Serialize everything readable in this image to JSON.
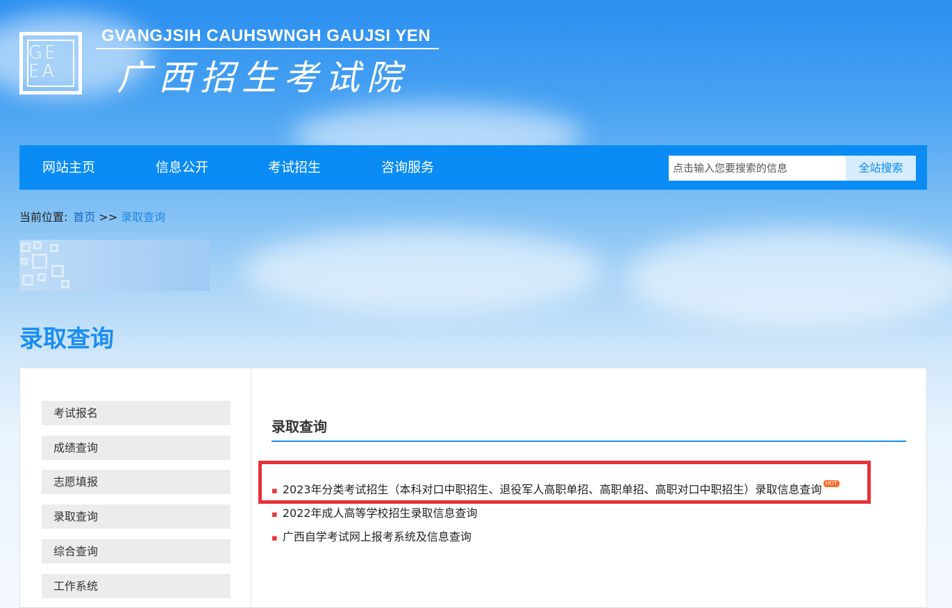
{
  "logo": {
    "letters": "GE EA",
    "en_name": "GVANGJSIH CAUHSWNGH GAUJSI YEN",
    "cn_name": "广西招生考试院"
  },
  "nav": {
    "items": [
      "网站主页",
      "信息公开",
      "考试招生",
      "咨询服务"
    ],
    "search_placeholder": "点击输入您要搜索的信息",
    "search_button": "全站搜索"
  },
  "breadcrumb": {
    "prefix": "当前位置:",
    "home": "首页",
    "separator": ">>",
    "current": "录取查询"
  },
  "page_heading": "录取查询",
  "sidebar": {
    "items": [
      "考试报名",
      "成绩查询",
      "志愿填报",
      "录取查询",
      "综合查询",
      "工作系统"
    ]
  },
  "content": {
    "title": "录取查询",
    "links": [
      {
        "text": "2023年分类考试招生（本科对口中职招生、退役军人高职单招、高职单招、高职对口中职招生）录取信息查询",
        "badge": "HOT"
      },
      {
        "text": "2022年成人高等学校招生录取信息查询",
        "badge": ""
      },
      {
        "text": "广西自学考试网上报考系统及信息查询",
        "badge": ""
      }
    ]
  },
  "colors": {
    "nav_bg": "#0a8cf4",
    "accent": "#1a8df0",
    "highlight": "#e53238",
    "hot_badge": "#ff6a24"
  }
}
